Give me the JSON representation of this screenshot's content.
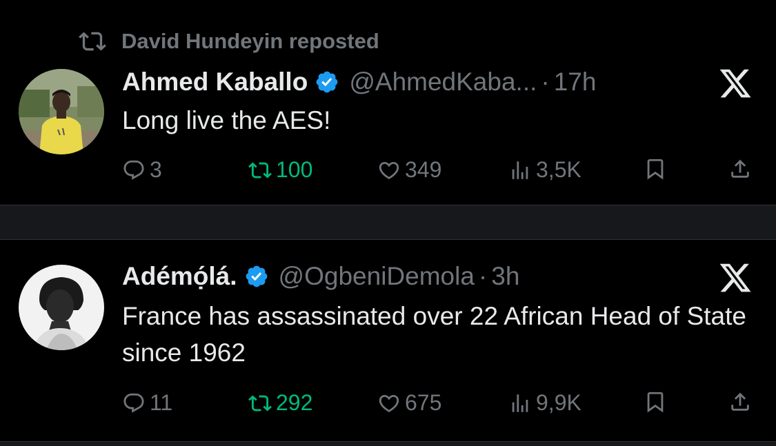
{
  "repost_banner": {
    "text": "David Hundeyin reposted"
  },
  "tweets": [
    {
      "name": "Ahmed Kaballo",
      "handle": "@AhmedKaba...",
      "dot": "·",
      "time": "17h",
      "text": "Long live the AES!",
      "replies": "3",
      "reposts": "100",
      "likes": "349",
      "views": "3,5K",
      "avatar_icon": "avatar-photo-icon"
    },
    {
      "name": "Adémọ́lá.",
      "handle": "@OgbeniDemola",
      "dot": "·",
      "time": "3h",
      "text": "France has assassinated over 22 African Head of State since 1962",
      "replies": "11",
      "reposts": "292",
      "likes": "675",
      "views": "9,9K",
      "avatar_icon": "avatar-photo-icon"
    }
  ],
  "colors": {
    "background": "#000000",
    "text": "#e7e9ea",
    "muted": "#71767b",
    "repost_active": "#00ba7c",
    "verified": "#1d9bf0",
    "separator": "#16181c"
  }
}
